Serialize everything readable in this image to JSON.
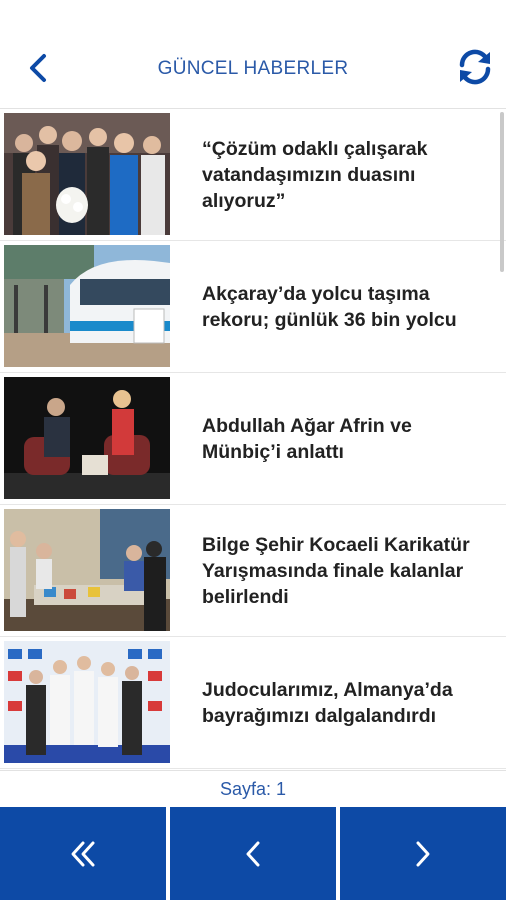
{
  "header": {
    "title": "GÜNCEL HABERLER",
    "back_icon": "chevron-left-icon",
    "refresh_icon": "refresh-icon",
    "accent_color": "#2b5aa8"
  },
  "news": [
    {
      "title": "“Çözüm odaklı çalışarak vatandaşımızın duasını alıyoruz”",
      "image": "group-photo-with-flowers"
    },
    {
      "title": "Akçaray’da yolcu taşıma rekoru; günlük 36 bin yolcu",
      "image": "tram-at-station"
    },
    {
      "title": "Abdullah Ağar Afrin ve Münbiç’i anlattı",
      "image": "stage-interview"
    },
    {
      "title": "Bilge Şehir Kocaeli Karikatür Yarışmasında finale kalanlar belirlendi",
      "image": "cartoon-competition-jury"
    },
    {
      "title": "Judocularımız, Almanya’da bayrağımızı dalgalandırdı",
      "image": "judo-podium"
    }
  ],
  "pagination": {
    "label": "Sayfa: 1",
    "first_icon": "double-chevron-left-icon",
    "prev_icon": "chevron-left-icon",
    "next_icon": "chevron-right-icon",
    "button_color": "#0d4aa6"
  }
}
